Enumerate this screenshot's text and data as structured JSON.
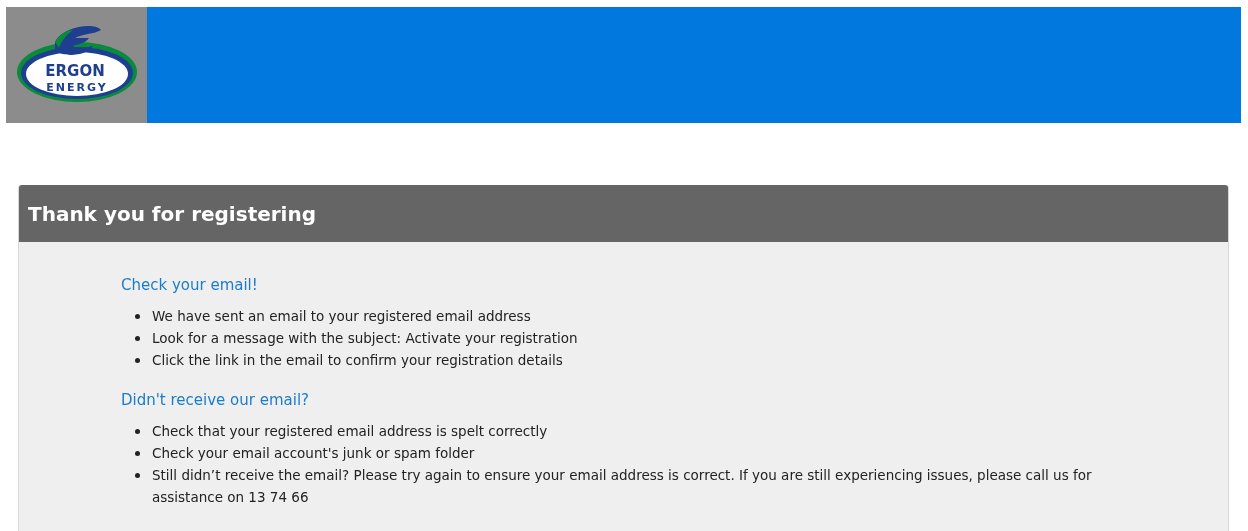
{
  "header": {
    "logo": {
      "line_1": "ERGON",
      "line_2": "ENERGY"
    }
  },
  "card": {
    "title": "Thank you for registering",
    "sections": [
      {
        "heading": "Check your email!",
        "items": [
          "We have sent an email to your registered email address",
          "Look for a message with the subject: Activate your registration",
          "Click the link in the email to confirm your registration details"
        ]
      },
      {
        "heading": "Didn't receive our email?",
        "items": [
          "Check that your registered email address is spelt correctly",
          "Check your email account's junk or spam folder",
          "Still didn’t receive the email? Please try again to ensure your email address is correct. If you are still experiencing issues, please call us for assistance on 13 74 66"
        ]
      }
    ]
  }
}
